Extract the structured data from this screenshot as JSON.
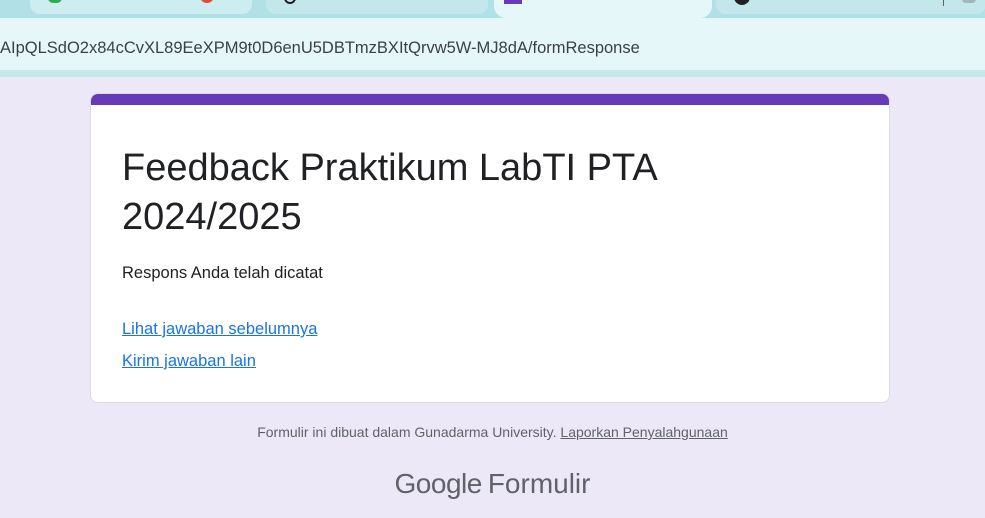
{
  "browser": {
    "url": "AIpQLSdO2x84cCvXL89EeXPM9t0D6enU5DBTmzBXItQrvw5W-MJ8dA/formResponse"
  },
  "form": {
    "title": "Feedback Praktikum LabTI PTA 2024/2025",
    "confirmation": "Respons Anda telah dicatat",
    "links": {
      "view_previous": "Lihat jawaban sebelumnya",
      "submit_another": "Kirim jawaban lain"
    },
    "accent_color": "#673ab7"
  },
  "footer": {
    "note": "Formulir ini dibuat dalam Gunadarma University.",
    "report_link": "Laporkan Penyalahgunaan",
    "brand_google": "Google",
    "brand_product": "Formulir"
  }
}
